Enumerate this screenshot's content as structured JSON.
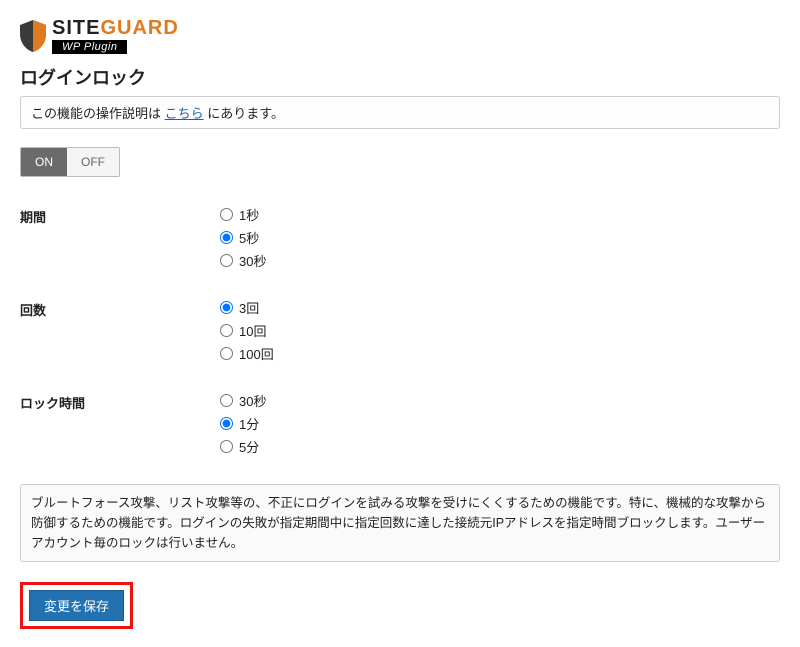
{
  "logo": {
    "text_main": "SITE",
    "text_accent": "GUARD",
    "badge": "WP Plugin"
  },
  "page_title": "ログインロック",
  "help": {
    "prefix": "この機能の操作説明は ",
    "link": "こちら",
    "suffix": " にあります。"
  },
  "toggle": {
    "on": "ON",
    "off": "OFF",
    "active": "ON"
  },
  "settings": {
    "period": {
      "label": "期間",
      "options": [
        "1秒",
        "5秒",
        "30秒"
      ],
      "selected": 1
    },
    "count": {
      "label": "回数",
      "options": [
        "3回",
        "10回",
        "100回"
      ],
      "selected": 0
    },
    "lock": {
      "label": "ロック時間",
      "options": [
        "30秒",
        "1分",
        "5分"
      ],
      "selected": 1
    }
  },
  "description": "ブルートフォース攻撃、リスト攻撃等の、不正にログインを試みる攻撃を受けにくくするための機能です。特に、機械的な攻撃から防御するための機能です。ログインの失敗が指定期間中に指定回数に達した接続元IPアドレスを指定時間ブロックします。ユーザーアカウント毎のロックは行いません。",
  "save_button": "変更を保存"
}
